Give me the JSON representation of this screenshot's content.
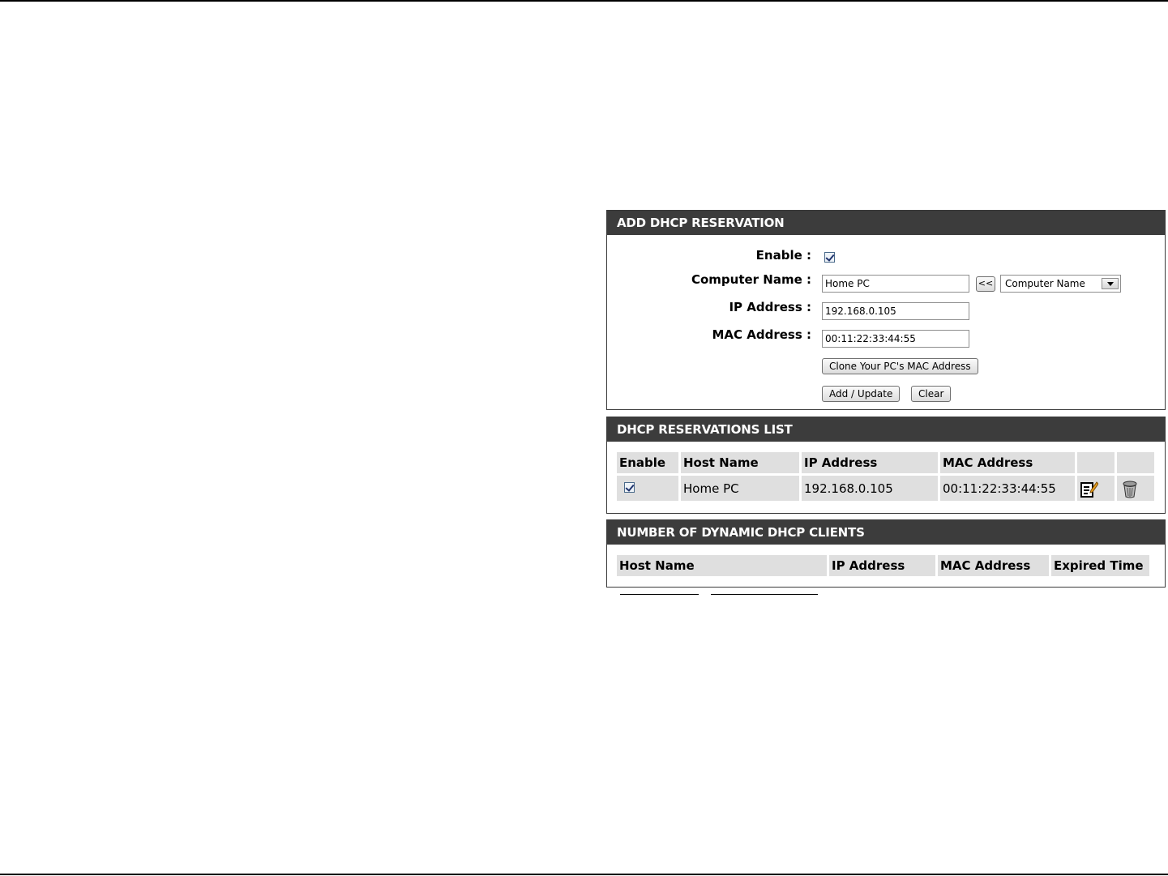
{
  "add_reservation": {
    "title": "ADD DHCP RESERVATION",
    "enable_label": "Enable :",
    "enable_checked": true,
    "computer_name_label": "Computer Name :",
    "computer_name_value": "Home PC",
    "copy_button_label": "<<",
    "computer_select_value": "Computer Name",
    "ip_label": "IP Address :",
    "ip_value": "192.168.0.105",
    "mac_label": "MAC Address :",
    "mac_value": "00:11:22:33:44:55",
    "clone_button_label": "Clone Your PC's MAC Address",
    "add_update_button_label": "Add / Update",
    "clear_button_label": "Clear"
  },
  "reservations_list": {
    "title": "DHCP RESERVATIONS LIST",
    "headers": [
      "Enable",
      "Host Name",
      "IP Address",
      "MAC Address"
    ],
    "rows": [
      {
        "enabled": true,
        "host_name": "Home PC",
        "ip": "192.168.0.105",
        "mac": "00:11:22:33:44:55",
        "edit_icon": "edit-icon",
        "delete_icon": "trash-icon"
      }
    ]
  },
  "dynamic_clients": {
    "title": "NUMBER OF DYNAMIC DHCP CLIENTS",
    "headers": [
      "Host Name",
      "IP Address",
      "MAC Address",
      "Expired Time"
    ]
  },
  "colors": {
    "panel_header_bg": "#3c3c3c",
    "panel_header_text": "#ffffff",
    "cell_bg": "#dfdfdf"
  }
}
